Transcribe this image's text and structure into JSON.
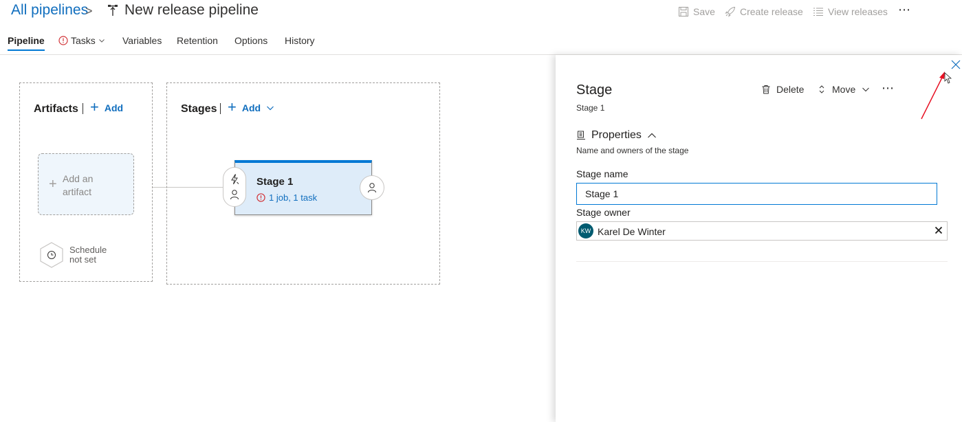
{
  "header": {
    "breadcrumb_root": "All pipelines",
    "separator": ">",
    "title": "New release pipeline",
    "actions": {
      "save": "Save",
      "create_release": "Create release",
      "view_releases": "View releases",
      "more": "⋯"
    }
  },
  "tabs": [
    {
      "label": "Pipeline",
      "active": true
    },
    {
      "label": "Tasks",
      "warning": true,
      "dropdown": true
    },
    {
      "label": "Variables"
    },
    {
      "label": "Retention"
    },
    {
      "label": "Options"
    },
    {
      "label": "History"
    }
  ],
  "artifacts": {
    "title": "Artifacts",
    "add_label": "Add",
    "placeholder_line1": "Add an",
    "placeholder_line2": "artifact",
    "schedule_line1": "Schedule",
    "schedule_line2": "not set"
  },
  "stages": {
    "title": "Stages",
    "add_label": "Add",
    "stage": {
      "name": "Stage 1",
      "summary": "1 job, 1 task"
    }
  },
  "panel": {
    "title": "Stage",
    "subtitle": "Stage 1",
    "delete_label": "Delete",
    "move_label": "Move",
    "more": "⋯",
    "properties_label": "Properties",
    "properties_desc": "Name and owners of the stage",
    "stage_name_label": "Stage name",
    "stage_name_value": "Stage 1",
    "stage_owner_label": "Stage owner",
    "owner": {
      "initials": "KW",
      "name": "Karel De Winter"
    }
  },
  "colors": {
    "accent": "#0078d4",
    "link": "#106ebe",
    "stage_fill": "#deecf9",
    "warning": "#d13438",
    "avatar": "#005b70",
    "annotation": "#e81123"
  }
}
